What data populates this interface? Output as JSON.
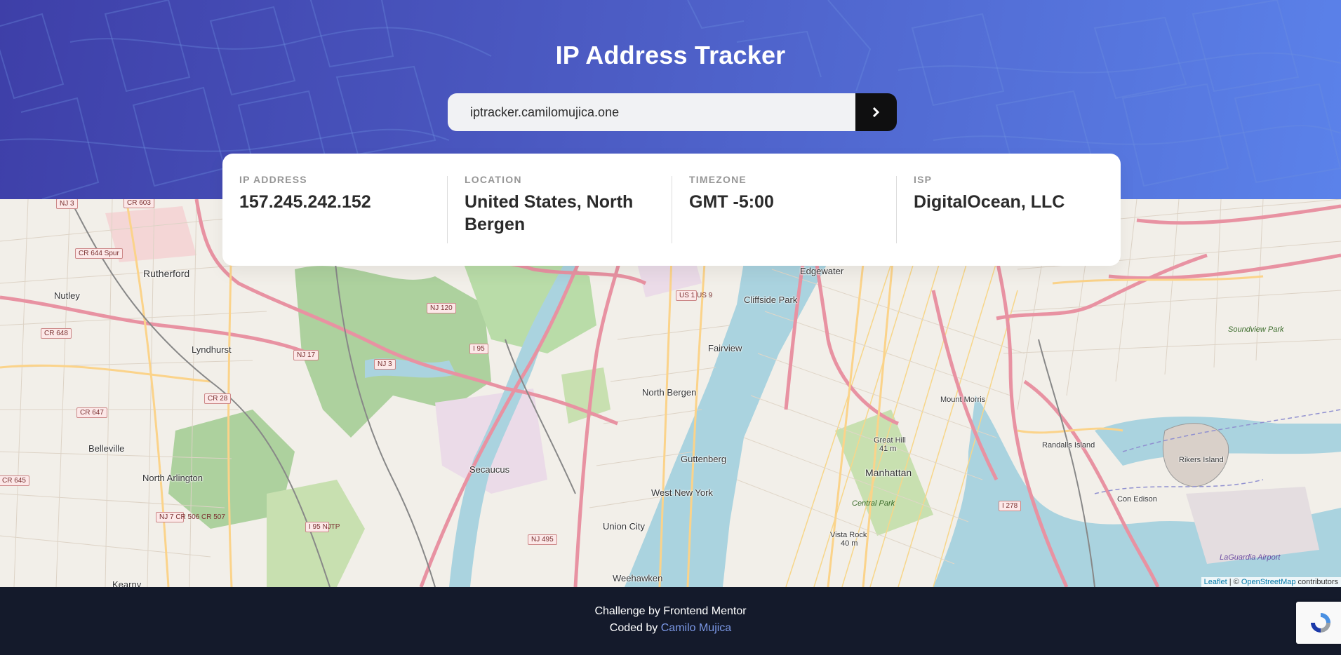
{
  "header": {
    "title": "IP Address Tracker",
    "search_value": "iptracker.camilomujica.one",
    "submit_icon": "chevron-right-icon"
  },
  "info": [
    {
      "label": "IP ADDRESS",
      "value": "157.245.242.152"
    },
    {
      "label": "LOCATION",
      "value": "United States, North Bergen"
    },
    {
      "label": "TIMEZONE",
      "value": "GMT -5:00"
    },
    {
      "label": "ISP",
      "value": "DigitalOcean, LLC"
    }
  ],
  "map": {
    "places": {
      "rutherford": "Rutherford",
      "nutley": "Nutley",
      "lyndhurst": "Lyndhurst",
      "belleville": "Belleville",
      "north_arlington": "North Arlington",
      "secaucus": "Secaucus",
      "north_bergen": "North Bergen",
      "guttenberg": "Guttenberg",
      "west_new_york": "West New York",
      "union_city": "Union City",
      "weehawken": "Weehawken",
      "fairview": "Fairview",
      "cliffside_park": "Cliffside Park",
      "edgewater": "Edgewater",
      "manhattan": "Manhattan",
      "central_park": "Central Park",
      "great_hill": "Great Hill",
      "great_hill_elev": "41 m",
      "vista_rock": "Vista Rock",
      "vista_rock_elev": "40 m",
      "mount_morris": "Mount Morris",
      "randalls_island": "Randalls Island",
      "rikers_island": "Rikers Island",
      "con_edison": "Con Edison",
      "laguardia": "LaGuardia Airport",
      "soundview_park": "Soundview Park",
      "kearny": "Kearny"
    },
    "shields": {
      "nj3_top": "NJ 3",
      "cr644": "CR 644 Spur",
      "cr648": "CR 648",
      "cr647": "CR 647",
      "cr28": "CR 28",
      "nj17": "NJ 17",
      "nj3": "NJ 3",
      "i95": "I 95",
      "nj120": "NJ 120",
      "us1": "US 1 US 9",
      "nj7": "NJ 7 CR 506 CR 507",
      "i95njtp": "I 95 NJTP",
      "nj495": "NJ 495",
      "i278": "I 278",
      "cr645": "CR 645",
      "cr603": "CR 603"
    },
    "attribution_leaflet": "Leaflet",
    "attribution_sep": " | © ",
    "attribution_osm": "OpenStreetMap",
    "attribution_tail": " contributors"
  },
  "footer": {
    "line1": "Challenge by Frontend Mentor",
    "line2_prefix": "Coded by ",
    "line2_author": "Camilo Mujica"
  }
}
